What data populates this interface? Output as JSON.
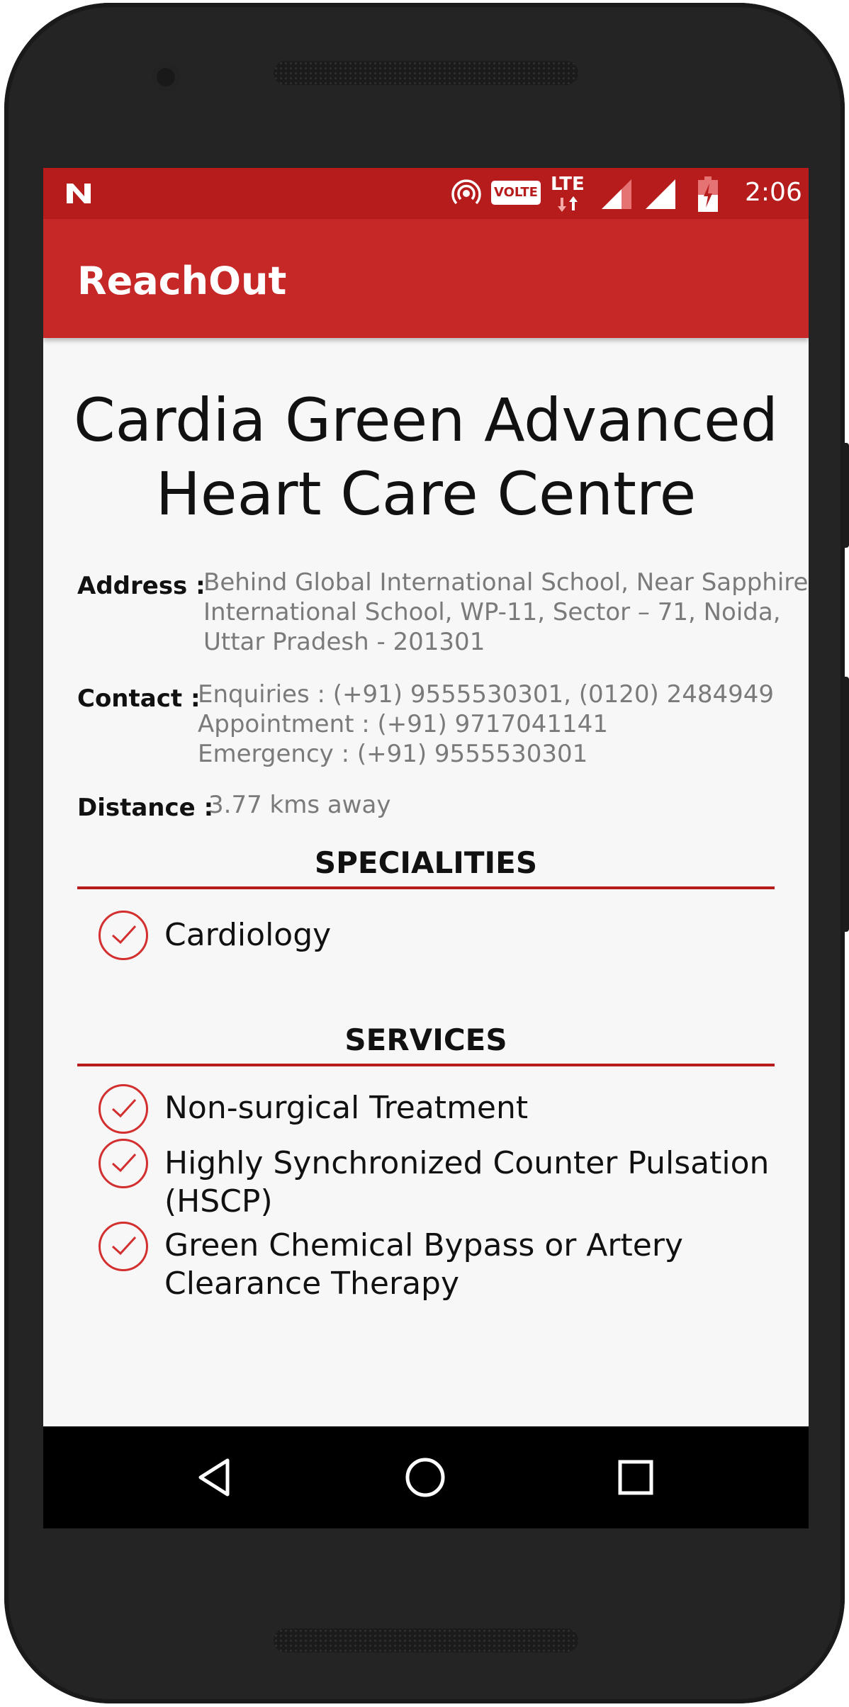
{
  "status_bar": {
    "time": "2:06",
    "volte_badge": "VOLTE",
    "network_type": "LTE",
    "icons": [
      "n-notification-icon",
      "hotspot-icon",
      "volte-icon",
      "lte-data-icon",
      "signal-icon",
      "signal-icon-2",
      "battery-icon"
    ]
  },
  "app_bar": {
    "title": "ReachOut"
  },
  "hospital": {
    "name": "Cardia Green Advanced Heart Care Centre",
    "address_label": "Address :",
    "address_lines": [
      "Behind Global International School, Near Sapphire",
      "International School, WP-11, Sector – 71, Noida,",
      "Uttar Pradesh - 201301"
    ],
    "contact_label": "Contact :",
    "contact_lines": [
      "Enquiries : (+91) 9555530301, (0120) 2484949",
      "Appointment : (+91) 9717041141",
      "Emergency : (+91) 9555530301"
    ],
    "distance_label": "Distance :",
    "distance_value": "3.77 kms away"
  },
  "specialities": {
    "title": "SPECIALITIES",
    "items": [
      "Cardiology"
    ]
  },
  "services": {
    "title": "SERVICES",
    "items": [
      [
        "Non-surgical Treatment"
      ],
      [
        "Highly Synchronized Counter Pulsation",
        "(HSCP)"
      ],
      [
        "Green Chemical Bypass or Artery",
        "Clearance Therapy"
      ]
    ]
  },
  "colors": {
    "status_bar": "#b71c1c",
    "app_bar": "#c62828",
    "accent": "#d32f2f",
    "background": "#f7f7f7"
  },
  "nav_bar": {
    "buttons": [
      "back-icon",
      "home-icon",
      "recents-icon"
    ]
  }
}
